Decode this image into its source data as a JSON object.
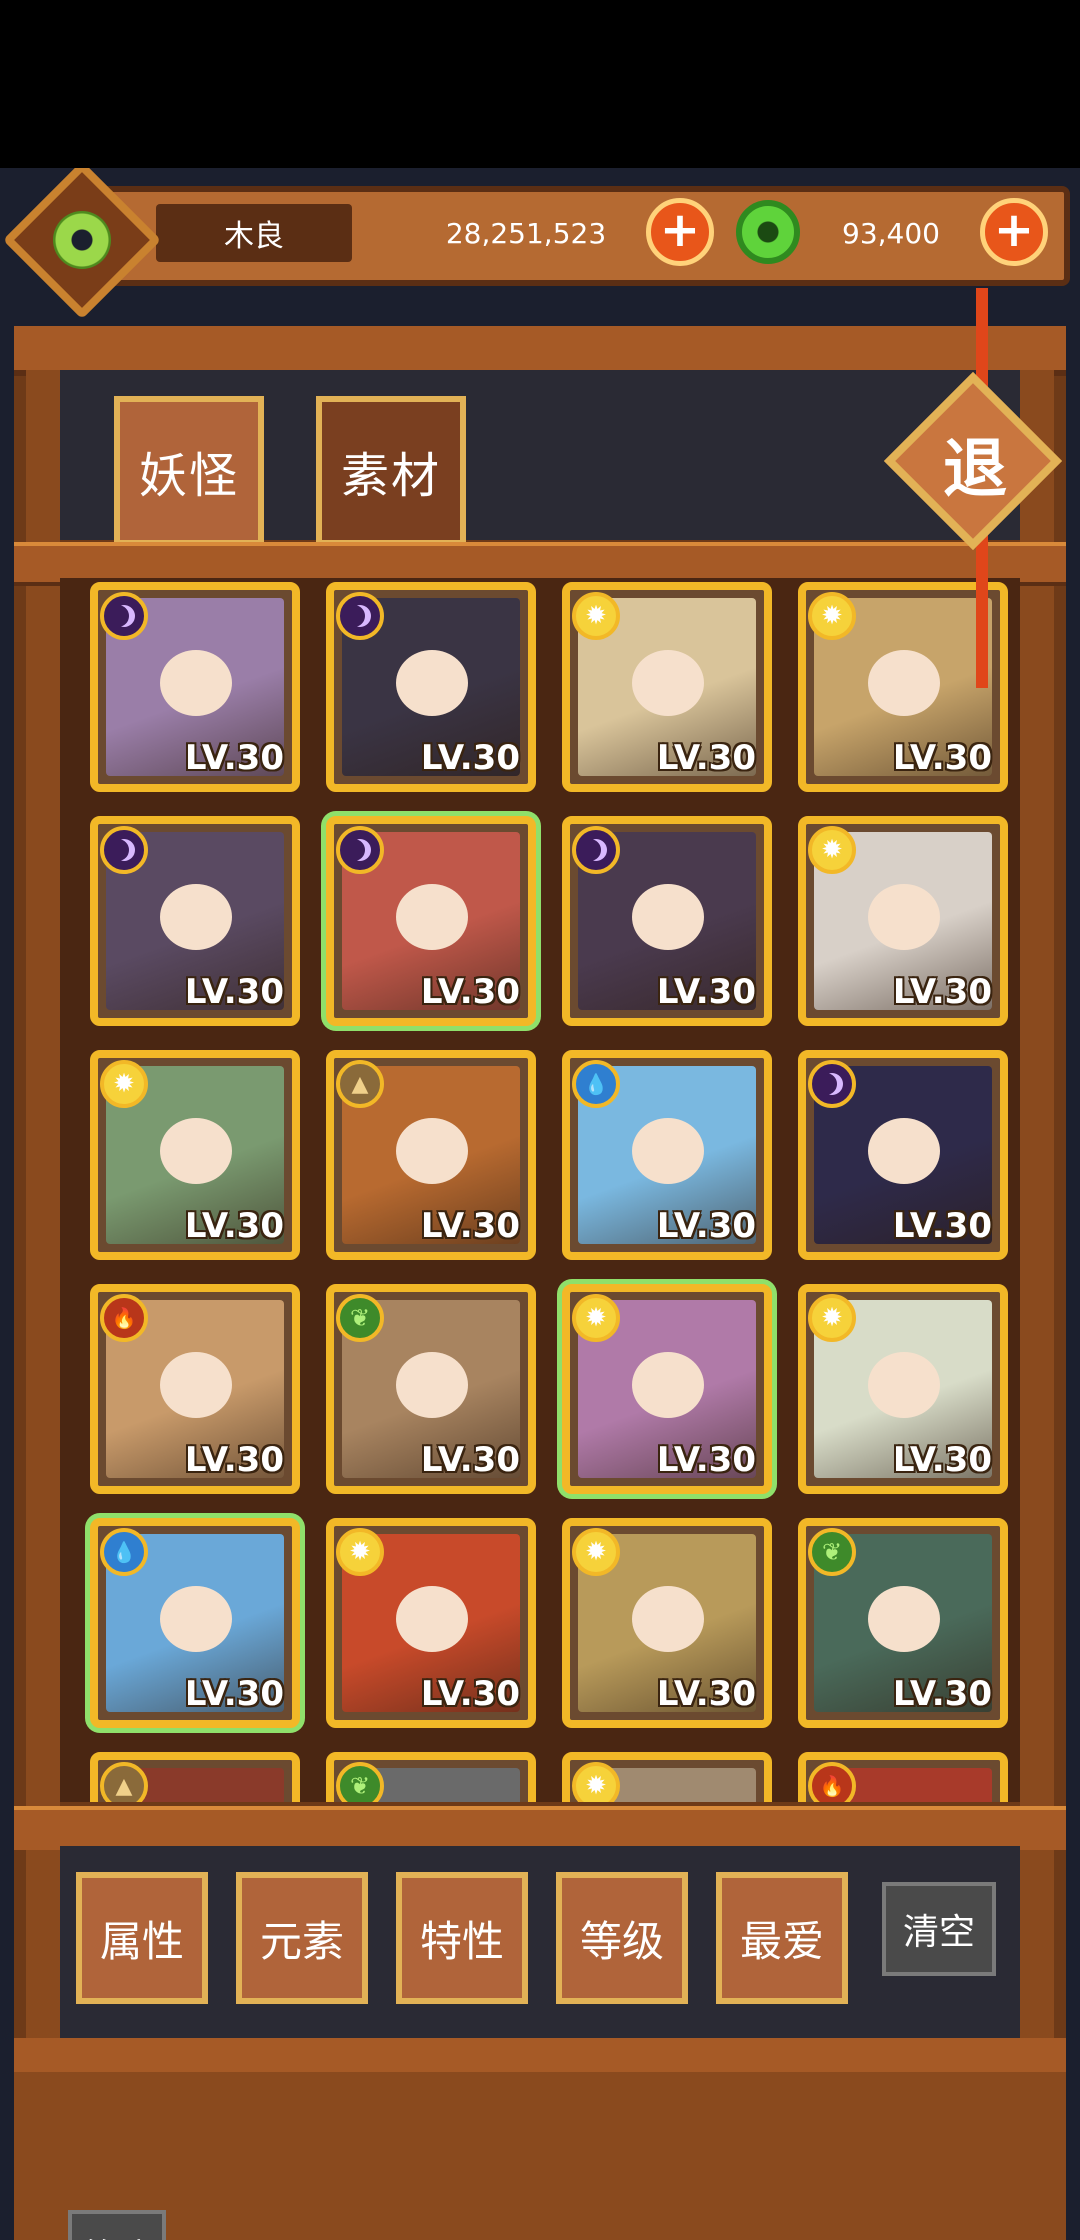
{
  "player": {
    "name": "木良",
    "avatar_icon": "jade-disc-icon"
  },
  "currency": {
    "gold": {
      "icon": "gold-coin-icon",
      "value": "28,251,523",
      "add_label": "+"
    },
    "jade": {
      "icon": "jade-coin-icon",
      "value": "93,400",
      "add_label": "+"
    }
  },
  "tabs": [
    {
      "label": "妖怪",
      "active": true
    },
    {
      "label": "素材",
      "active": false
    }
  ],
  "exit_label": "退",
  "cards": [
    {
      "element": "dark",
      "level": "LV.30",
      "glow": false,
      "color": "#9a7ea8"
    },
    {
      "element": "dark",
      "level": "LV.30",
      "glow": false,
      "color": "#3a3444"
    },
    {
      "element": "light",
      "level": "LV.30",
      "glow": false,
      "color": "#d9c49a"
    },
    {
      "element": "light",
      "level": "LV.30",
      "glow": false,
      "color": "#c7a46a"
    },
    {
      "element": "dark",
      "level": "LV.30",
      "glow": false,
      "color": "#5a4a62"
    },
    {
      "element": "dark",
      "level": "LV.30",
      "glow": true,
      "color": "#c0584a"
    },
    {
      "element": "dark",
      "level": "LV.30",
      "glow": false,
      "color": "#4a3a4e"
    },
    {
      "element": "light",
      "level": "LV.30",
      "glow": false,
      "color": "#d8d0c8"
    },
    {
      "element": "light",
      "level": "LV.30",
      "glow": false,
      "color": "#7a9a70"
    },
    {
      "element": "earth",
      "level": "LV.30",
      "glow": false,
      "color": "#b86a30"
    },
    {
      "element": "water",
      "level": "LV.30",
      "glow": false,
      "color": "#7ab8e0"
    },
    {
      "element": "dark",
      "level": "LV.30",
      "glow": false,
      "color": "#2e2a4a"
    },
    {
      "element": "fire",
      "level": "LV.30",
      "glow": false,
      "color": "#c89a6a"
    },
    {
      "element": "wood",
      "level": "LV.30",
      "glow": false,
      "color": "#a88460"
    },
    {
      "element": "light",
      "level": "LV.30",
      "glow": true,
      "color": "#b07aa8"
    },
    {
      "element": "light",
      "level": "LV.30",
      "glow": false,
      "color": "#d8dcc8"
    },
    {
      "element": "water",
      "level": "LV.30",
      "glow": true,
      "color": "#6aa8d8"
    },
    {
      "element": "light",
      "level": "LV.30",
      "glow": false,
      "color": "#c84a2a"
    },
    {
      "element": "light",
      "level": "LV.30",
      "glow": false,
      "color": "#b89a5a"
    },
    {
      "element": "wood",
      "level": "LV.30",
      "glow": false,
      "color": "#4a6a5a"
    },
    {
      "element": "earth",
      "level": "",
      "glow": false,
      "color": "#8a3a2a"
    },
    {
      "element": "wood",
      "level": "",
      "glow": false,
      "color": "#6a6a6a"
    },
    {
      "element": "light",
      "level": "",
      "glow": false,
      "color": "#a08a70"
    },
    {
      "element": "fire",
      "level": "",
      "glow": false,
      "color": "#a83a2a"
    }
  ],
  "filters": [
    {
      "label": "属性"
    },
    {
      "label": "元素"
    },
    {
      "label": "特性"
    },
    {
      "label": "等级"
    },
    {
      "label": "最爱"
    }
  ],
  "clear_label": "清空",
  "screen_label": "筛选"
}
